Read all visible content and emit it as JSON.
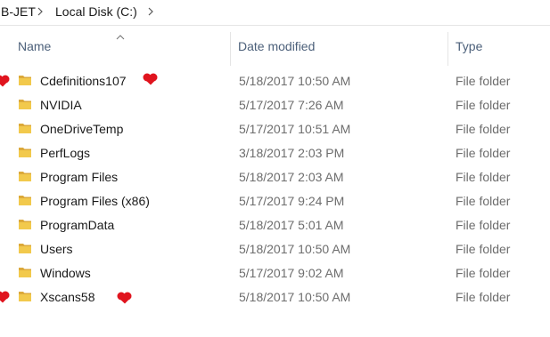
{
  "breadcrumb": {
    "items": [
      "B-JET",
      "Local Disk (C:)"
    ]
  },
  "columns": {
    "name": "Name",
    "date_modified": "Date modified",
    "type": "Type"
  },
  "colors": {
    "folder": "#f2c94c",
    "folder_dark": "#dca93a",
    "marker": "#e0141e",
    "header_text": "#4c607a"
  },
  "rows": [
    {
      "name": "Cdefinitions107",
      "date": "5/18/2017 10:50 AM",
      "type": "File folder",
      "icon": "folder-icon",
      "marked": true
    },
    {
      "name": "NVIDIA",
      "date": "5/17/2017 7:26 AM",
      "type": "File folder",
      "icon": "folder-icon",
      "marked": false
    },
    {
      "name": "OneDriveTemp",
      "date": "5/17/2017 10:51 AM",
      "type": "File folder",
      "icon": "folder-icon",
      "marked": false
    },
    {
      "name": "PerfLogs",
      "date": "3/18/2017 2:03 PM",
      "type": "File folder",
      "icon": "folder-icon",
      "marked": false
    },
    {
      "name": "Program Files",
      "date": "5/18/2017 2:03 AM",
      "type": "File folder",
      "icon": "folder-icon",
      "marked": false
    },
    {
      "name": "Program Files (x86)",
      "date": "5/17/2017 9:24 PM",
      "type": "File folder",
      "icon": "folder-icon",
      "marked": false
    },
    {
      "name": "ProgramData",
      "date": "5/18/2017 5:01 AM",
      "type": "File folder",
      "icon": "folder-icon",
      "marked": false
    },
    {
      "name": "Users",
      "date": "5/18/2017 10:50 AM",
      "type": "File folder",
      "icon": "folder-icon",
      "marked": false
    },
    {
      "name": "Windows",
      "date": "5/17/2017 9:02 AM",
      "type": "File folder",
      "icon": "folder-icon",
      "marked": false
    },
    {
      "name": "Xscans58",
      "date": "5/18/2017 10:50 AM",
      "type": "File folder",
      "icon": "folder-icon",
      "marked": true
    }
  ]
}
